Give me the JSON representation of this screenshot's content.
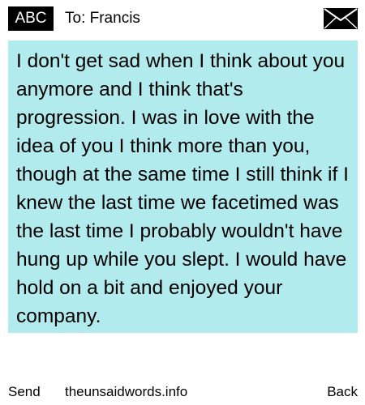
{
  "header": {
    "mode_badge": "ABC",
    "recipient": "To: Francis",
    "mail_icon": "envelope-icon"
  },
  "message": {
    "text": "I don't get sad when I think about you anymore and I think that's progression. I was in love with the idea of you I think more than you, though at the same time I still think if I knew the last time we facetimed was the last time I probably wouldn't have hung up while you slept. I would have hold on a bit and enjoyed your company."
  },
  "footer": {
    "send_label": "Send",
    "site": "theunsaidwords.info",
    "back_label": "Back"
  },
  "colors": {
    "message_background": "#b2ebed",
    "badge_background": "#000000",
    "badge_text": "#ffffff"
  }
}
